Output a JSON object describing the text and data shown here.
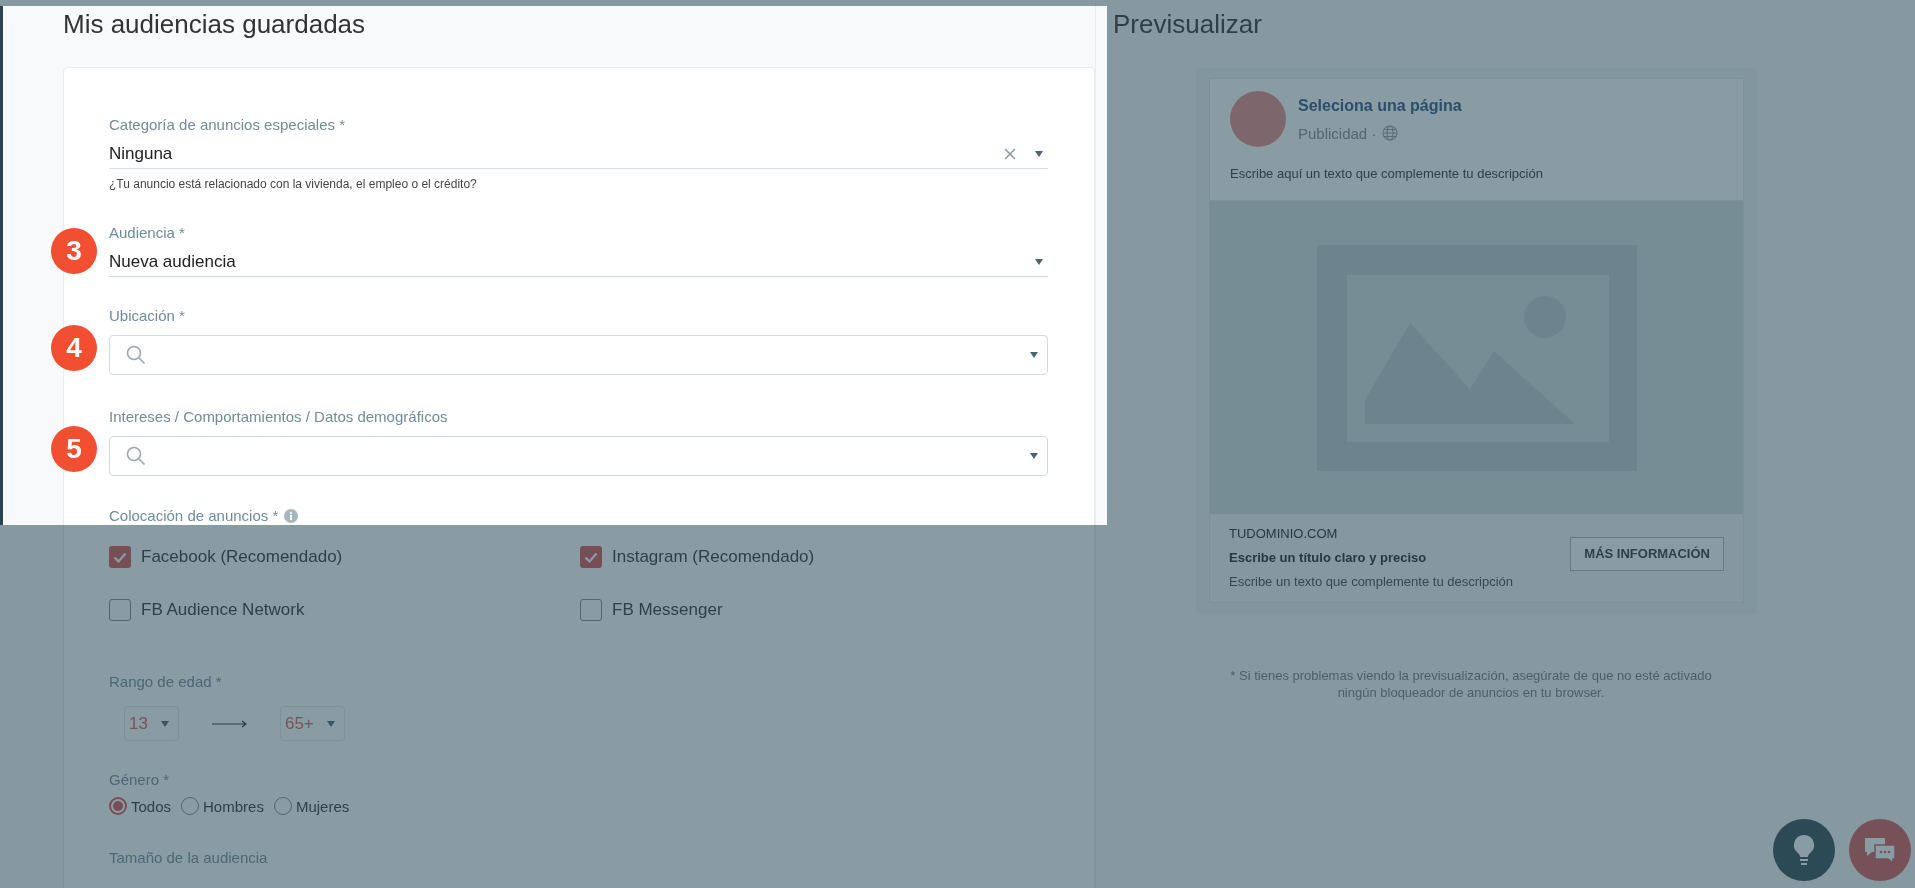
{
  "form_panel": {
    "title": "Mis audiencias guardadas",
    "special_category": {
      "label": "Categoría de anuncios especiales *",
      "value": "Ninguna",
      "helper": "¿Tu anuncio está relacionado con la vivienda, el empleo o el crédito?"
    },
    "audience": {
      "step": "3",
      "label": "Audiencia *",
      "value": "Nueva audiencia"
    },
    "location": {
      "step": "4",
      "label": "Ubicación *"
    },
    "interests": {
      "step": "5",
      "label": "Intereses / Comportamientos / Datos demográficos"
    },
    "placements": {
      "label": "Colocación de anuncios *",
      "options": [
        {
          "label": "Facebook (Recomendado)",
          "checked": true
        },
        {
          "label": "Instagram (Recomendado)",
          "checked": true
        },
        {
          "label": "FB Audience Network",
          "checked": false
        },
        {
          "label": "FB Messenger",
          "checked": false
        }
      ]
    },
    "age_range": {
      "label": "Rango de edad *",
      "min": "13",
      "max": "65+"
    },
    "gender": {
      "label": "Género *",
      "options": [
        {
          "label": "Todos",
          "selected": true
        },
        {
          "label": "Hombres",
          "selected": false
        },
        {
          "label": "Mujeres",
          "selected": false
        }
      ]
    },
    "audience_size": {
      "label": "Tamaño de la audiencia"
    }
  },
  "preview": {
    "title": "Previsualizar",
    "page_name": "Seleciona una página",
    "sponsored": "Publicidad ·",
    "post_text": "Escribe aquí un texto que complemente tu descripción",
    "domain": "TUDOMINIO.COM",
    "headline": "Escribe un título claro y preciso",
    "description": "Escribe un texto que complemente tu descripción",
    "cta": "MÁS INFORMACIÓN",
    "note": "* Si tienes problemas viendo la previsualización, asegúrate de que no esté activado ningún bloqueador de anuncios en tu browser."
  }
}
